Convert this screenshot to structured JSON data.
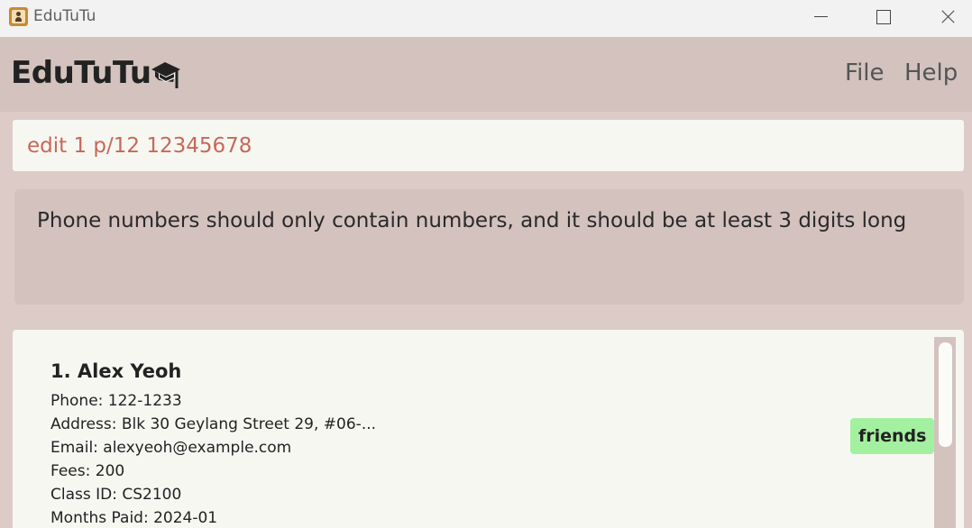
{
  "window": {
    "title": "EduTuTu",
    "app_icon": "contact-book-icon",
    "controls": [
      "minimize-icon",
      "maximize-icon",
      "close-icon"
    ]
  },
  "header": {
    "brand": "EduTuTu",
    "brand_icon": "graduation-cap-icon",
    "menu": {
      "file": "File",
      "help": "Help"
    }
  },
  "command": {
    "value": "edit 1 p/12 12345678",
    "text_color": "#c76858"
  },
  "result": {
    "message": "Phone numbers should only contain numbers, and it should be at least 3 digits long"
  },
  "persons": [
    {
      "index": "1.",
      "name": "Alex Yeoh",
      "name_display": "1.  Alex Yeoh",
      "phone": "Phone:  122-1233",
      "address": "Address:  Blk 30 Geylang Street 29, #06-...",
      "email": "Email:  alexyeoh@example.com",
      "fees": "Fees:  200",
      "class_id": "Class ID:  CS2100",
      "months_paid": "Months Paid:  2024-01",
      "tags": [
        "friends"
      ]
    }
  ],
  "colors": {
    "background": "#dccbc7",
    "header": "#d3c2be",
    "panel": "#f7f7f2",
    "tag": "#a3f0a0"
  }
}
